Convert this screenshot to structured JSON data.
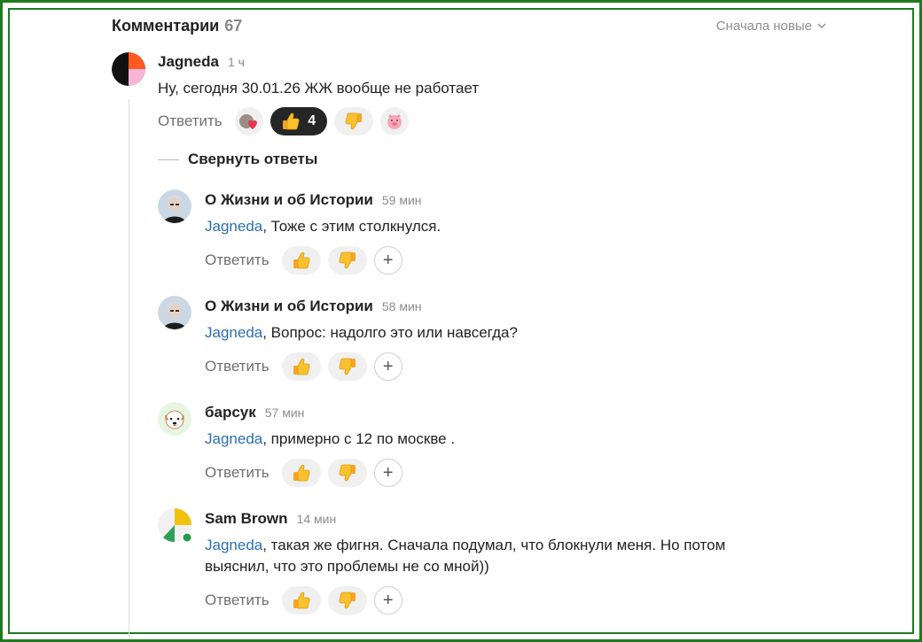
{
  "header": {
    "title": "Комментарии",
    "count": "67",
    "sort_label": "Сначала новые"
  },
  "collapse_label": "Свернуть ответы",
  "comments": [
    {
      "author": "Jagneda",
      "time": "1 ч",
      "text": "Ну, сегодня 30.01.26 ЖЖ вообще не работает",
      "reply_label": "Ответить",
      "like_count": "4"
    },
    {
      "author": "О Жизни и об Истории",
      "time": "59 мин",
      "mention": "Jagneda",
      "text": ", Тоже с этим столкнулся.",
      "reply_label": "Ответить"
    },
    {
      "author": "О Жизни и об Истории",
      "time": "58 мин",
      "mention": "Jagneda",
      "text": ", Вопрос: надолго это или навсегда?",
      "reply_label": "Ответить"
    },
    {
      "author": "барсук",
      "time": "57 мин",
      "mention": "Jagneda",
      "text": ", примерно с 12 по москве .",
      "reply_label": "Ответить"
    },
    {
      "author": "Sam Brown",
      "time": "14 мин",
      "mention": "Jagneda",
      "text": ", такая же фигня. Сначала подумал, что блокнули меня. Но потом",
      "text2": "выяснил, что это проблемы не со мной))",
      "reply_label": "Ответить"
    }
  ],
  "icons": {
    "thumbs_up": "thumbs-up-icon",
    "thumbs_down": "thumbs-down-icon",
    "plus": "+",
    "sort_chevron": "chevron-down-icon"
  },
  "colors": {
    "mention": "#2a6fb3",
    "frame": "#1f7a1f",
    "online": "#1f9d4d"
  }
}
